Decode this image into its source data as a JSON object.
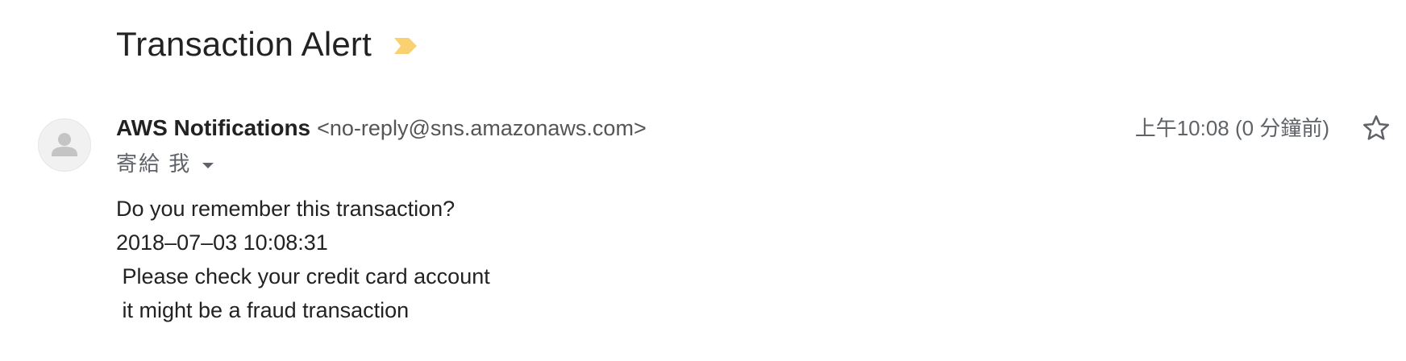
{
  "email": {
    "subject": "Transaction Alert",
    "sender_name": "AWS Notifications",
    "sender_email": "<no-reply@sns.amazonaws.com>",
    "recipient_label": "寄給 我",
    "timestamp": "上午10:08 (0 分鐘前)",
    "body_lines": [
      "Do you remember this transaction?",
      "2018–07–03 10:08:31",
      " Please check your credit card account",
      " it might be a fraud transaction"
    ]
  },
  "icons": {
    "importance": "importance-marker-icon",
    "avatar": "person-icon",
    "dropdown": "chevron-down-icon",
    "star": "star-icon"
  },
  "colors": {
    "importance_marker": "#f9d171",
    "text_primary": "#222222",
    "text_secondary": "#5f6368"
  }
}
